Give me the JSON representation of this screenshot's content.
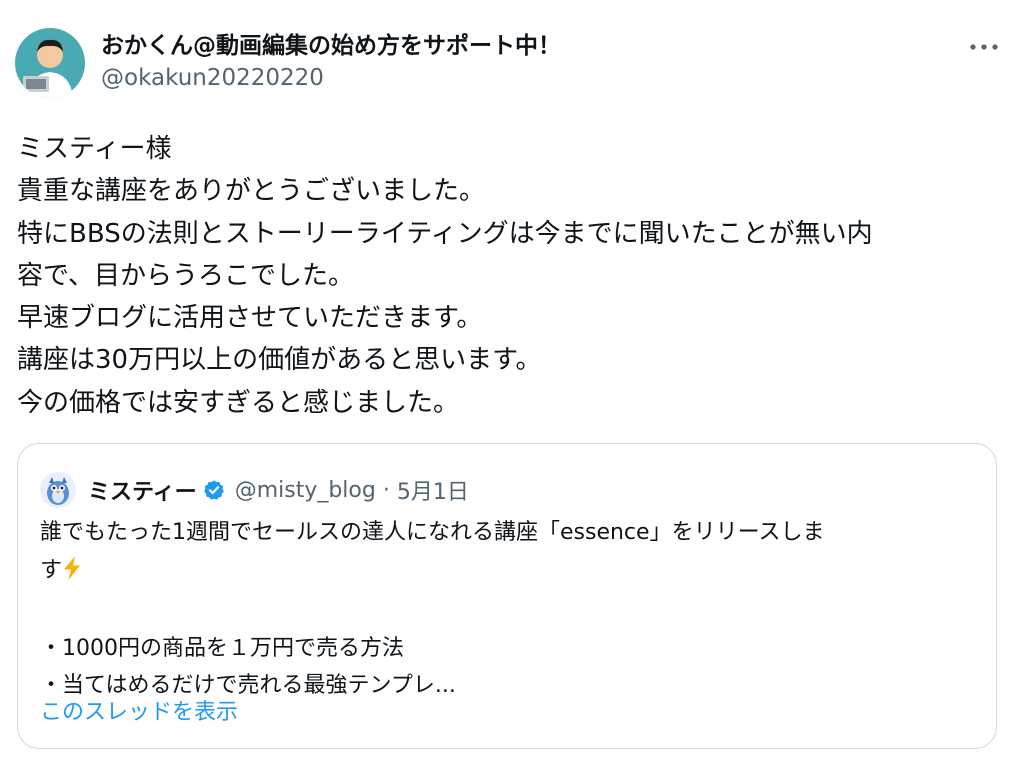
{
  "tweet": {
    "author": {
      "display_name": "おかくん@動画編集の始め方をサポート中！",
      "handle": "@okakun20220220"
    },
    "body_lines": [
      "ミスティー様",
      "貴重な講座をありがとうございました。",
      "特にBBSの法則とストーリーライティングは今までに聞いたことが無い内",
      "容で、目からうろこでした。",
      "早速ブログに活用させていただきます。",
      "講座は30万円以上の価値があると思います。",
      "今の価格では安すぎると感じました。"
    ],
    "quote": {
      "display_name": "ミスティー",
      "handle": "@misty_blog",
      "separator": "·",
      "date": "5月1日",
      "line1": "誰でもたった1週間でセールスの達人になれる講座「essence」をリリースしま",
      "line2": "す",
      "line3": "",
      "line4": "・1000円の商品を１万円で売る方法",
      "line5": "・当てはめるだけで売れる最強テンプレ...",
      "show_thread": "このスレッドを表示"
    }
  },
  "icons": {
    "more": "more-horizontal-icon",
    "verified": "verified-badge-icon",
    "bolt": "high-voltage-icon"
  },
  "colors": {
    "text_primary": "#0f1419",
    "text_secondary": "#536471",
    "link": "#1d9bf0",
    "border": "#cfd9de",
    "verified": "#1d9bf0",
    "bolt": "#f4b400"
  }
}
